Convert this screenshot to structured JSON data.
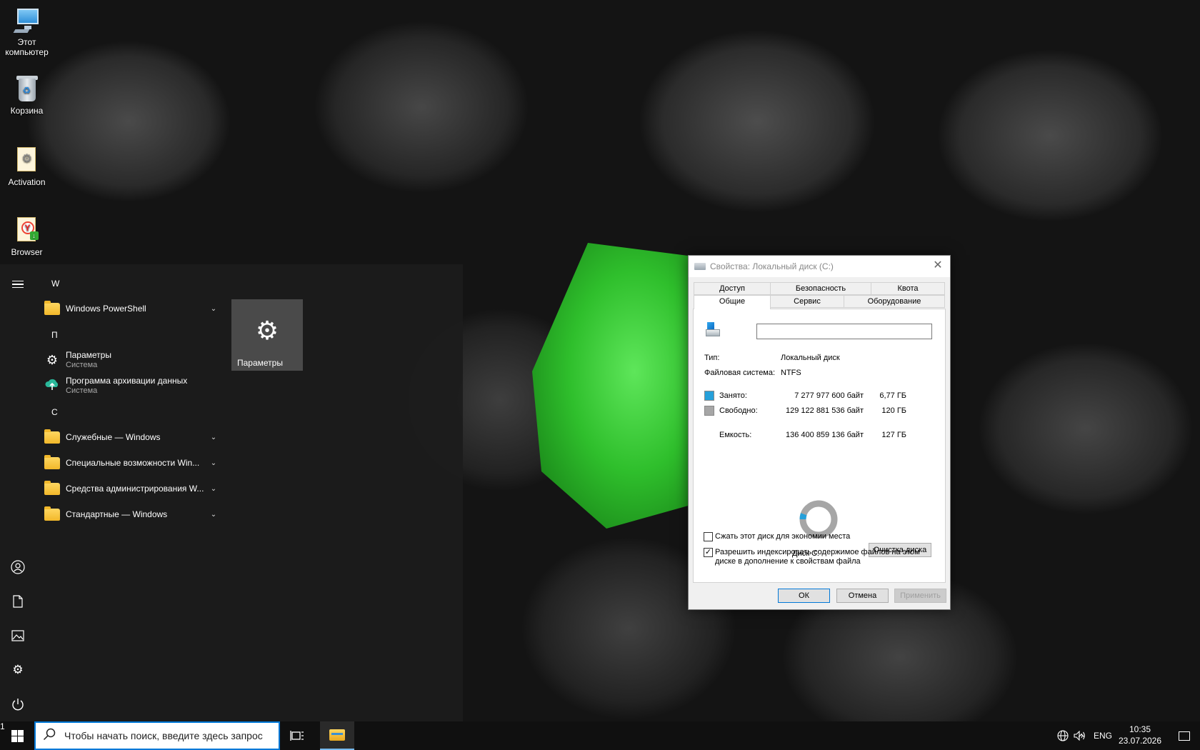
{
  "desktop": {
    "icons": [
      {
        "label": "Этот\nкомпьютер",
        "line1": "Этот",
        "line2": "компьютер",
        "icon": "computer-icon"
      },
      {
        "label": "Корзина",
        "icon": "recycle-bin-icon"
      },
      {
        "label": "Activation",
        "icon": "activation-folder-icon"
      },
      {
        "label": "Browser",
        "icon": "yandex-browser-icon"
      }
    ]
  },
  "start_menu": {
    "groups": [
      {
        "letter": "W",
        "items": [
          {
            "label": "Windows PowerShell",
            "expandable": true
          }
        ]
      },
      {
        "letter": "П",
        "items": [
          {
            "label": "Параметры",
            "sub": "Система",
            "icon": "gear-icon"
          },
          {
            "label": "Программа архивации данных",
            "sub": "Система",
            "icon": "cloud-upload-icon"
          }
        ]
      },
      {
        "letter": "С",
        "items": [
          {
            "label": "Служебные — Windows",
            "expandable": true
          },
          {
            "label": "Специальные возможности Win...",
            "expandable": true
          },
          {
            "label": "Средства администрирования W...",
            "expandable": true
          },
          {
            "label": "Стандартные — Windows",
            "expandable": true
          }
        ]
      }
    ],
    "tile": {
      "label": "Параметры",
      "icon": "gear-icon"
    },
    "rail_icons": [
      "hamburger-icon",
      "user-icon",
      "document-icon",
      "pictures-icon",
      "gear-icon",
      "power-icon"
    ]
  },
  "dialog": {
    "title": "Свойства: Локальный диск (C:)",
    "tabs_row1": [
      "Доступ",
      "Безопасность",
      "Квота"
    ],
    "tabs_row2": [
      "Общие",
      "Сервис",
      "Оборудование"
    ],
    "active_tab": "Общие",
    "volume_name": "",
    "type_label": "Тип:",
    "type_value": "Локальный диск",
    "fs_label": "Файловая система:",
    "fs_value": "NTFS",
    "used": {
      "label": "Занято:",
      "bytes": "7 277 977 600 байт",
      "size": "6,77 ГБ",
      "color": "#26a0da"
    },
    "free": {
      "label": "Свободно:",
      "bytes": "129 122 881 536 байт",
      "size": "120 ГБ",
      "color": "#a6a6a6"
    },
    "capacity": {
      "label": "Емкость:",
      "bytes": "136 400 859 136 байт",
      "size": "127 ГБ"
    },
    "used_fraction": 0.0534,
    "disk_label": "Диск C:",
    "cleanup_button": "Очистка диска",
    "compress_label": "Сжать этот диск для экономии места",
    "compress_checked": false,
    "index_label_line1": "Разрешить индексировать содержимое файлов на этом",
    "index_label_line2": "диске в дополнение к свойствам файла",
    "index_checked": true,
    "ok": "ОК",
    "cancel": "Отмена",
    "apply": "Применить"
  },
  "taskbar": {
    "search_placeholder": "Чтобы начать поиск, введите здесь запрос",
    "lang": "ENG",
    "time": "10:35",
    "date": "23.07.2026",
    "notification_count": "1"
  },
  "colors": {
    "accent": "#0078d7",
    "start_bg": "#1c1c1c",
    "tile_bg": "#4a4a4a"
  }
}
